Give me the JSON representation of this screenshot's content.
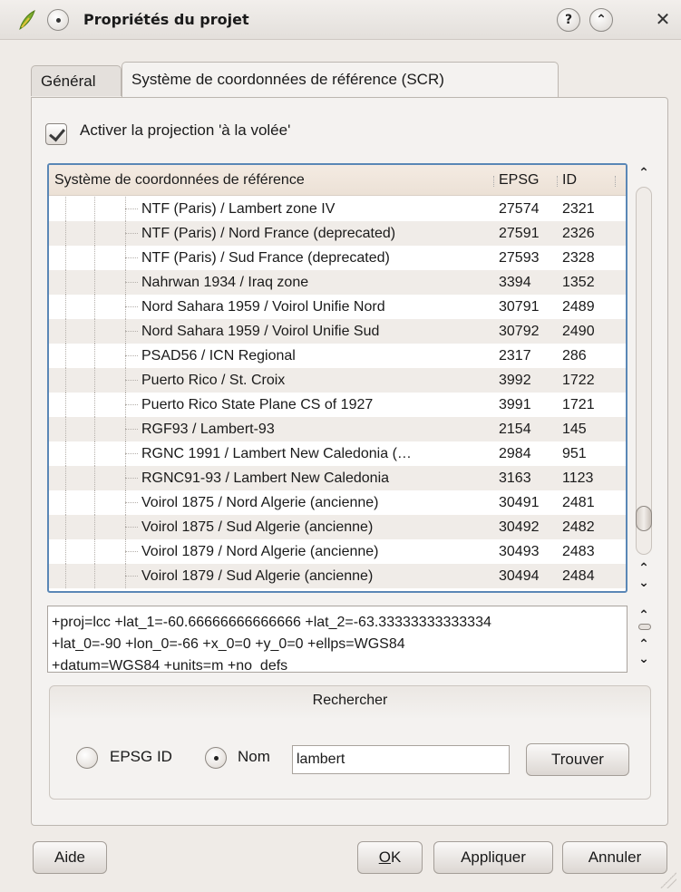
{
  "window": {
    "title": "Propriétés du projet",
    "help_button": "?",
    "shade_button": "⌃",
    "close_button": "✕"
  },
  "tabs": [
    {
      "label": "Général",
      "active": false
    },
    {
      "label": "Système de coordonnées de référence (SCR)",
      "active": true
    }
  ],
  "otf_checkbox": {
    "label": "Activer la projection 'à la volée'",
    "checked": true
  },
  "crs_table": {
    "columns": [
      "Système de coordonnées de référence",
      "EPSG",
      "ID"
    ],
    "rows": [
      {
        "name": "NTF (Paris) / Lambert zone IV",
        "epsg": "27574",
        "id": "2321"
      },
      {
        "name": "NTF (Paris) / Nord France (deprecated)",
        "epsg": "27591",
        "id": "2326"
      },
      {
        "name": "NTF (Paris) / Sud France (deprecated)",
        "epsg": "27593",
        "id": "2328"
      },
      {
        "name": "Nahrwan 1934 / Iraq zone",
        "epsg": "3394",
        "id": "1352"
      },
      {
        "name": "Nord Sahara 1959 / Voirol Unifie Nord",
        "epsg": "30791",
        "id": "2489"
      },
      {
        "name": "Nord Sahara 1959 / Voirol Unifie Sud",
        "epsg": "30792",
        "id": "2490"
      },
      {
        "name": "PSAD56 / ICN Regional",
        "epsg": "2317",
        "id": "286"
      },
      {
        "name": "Puerto Rico / St. Croix",
        "epsg": "3992",
        "id": "1722"
      },
      {
        "name": "Puerto Rico State Plane CS of 1927",
        "epsg": "3991",
        "id": "1721"
      },
      {
        "name": "RGF93 / Lambert-93",
        "epsg": "2154",
        "id": "145"
      },
      {
        "name": "RGNC 1991 / Lambert New Caledonia (…",
        "epsg": "2984",
        "id": "951"
      },
      {
        "name": "RGNC91-93 / Lambert New Caledonia",
        "epsg": "3163",
        "id": "1123"
      },
      {
        "name": "Voirol 1875 / Nord Algerie (ancienne)",
        "epsg": "30491",
        "id": "2481"
      },
      {
        "name": "Voirol 1875 / Sud Algerie (ancienne)",
        "epsg": "30492",
        "id": "2482"
      },
      {
        "name": "Voirol 1879 / Nord Algerie (ancienne)",
        "epsg": "30493",
        "id": "2483"
      },
      {
        "name": "Voirol 1879 / Sud Algerie (ancienne)",
        "epsg": "30494",
        "id": "2484"
      }
    ]
  },
  "proj_text": "+proj=lcc +lat_1=-60.66666666666666 +lat_2=-63.33333333333334\n+lat_0=-90 +lon_0=-66 +x_0=0 +y_0=0 +ellps=WGS84\n+datum=WGS84 +units=m +no_defs",
  "search": {
    "title": "Rechercher",
    "option_epsg": "EPSG ID",
    "option_name": "Nom",
    "selected_option": "Nom",
    "query": "lambert",
    "find_button": "Trouver"
  },
  "buttons": {
    "help": "Aide",
    "ok": "OK",
    "apply": "Appliquer",
    "cancel": "Annuler"
  },
  "colors": {
    "window_bg": "#efebe7",
    "table_border": "#5a87b6",
    "header_bg": "#f4ebe2"
  }
}
